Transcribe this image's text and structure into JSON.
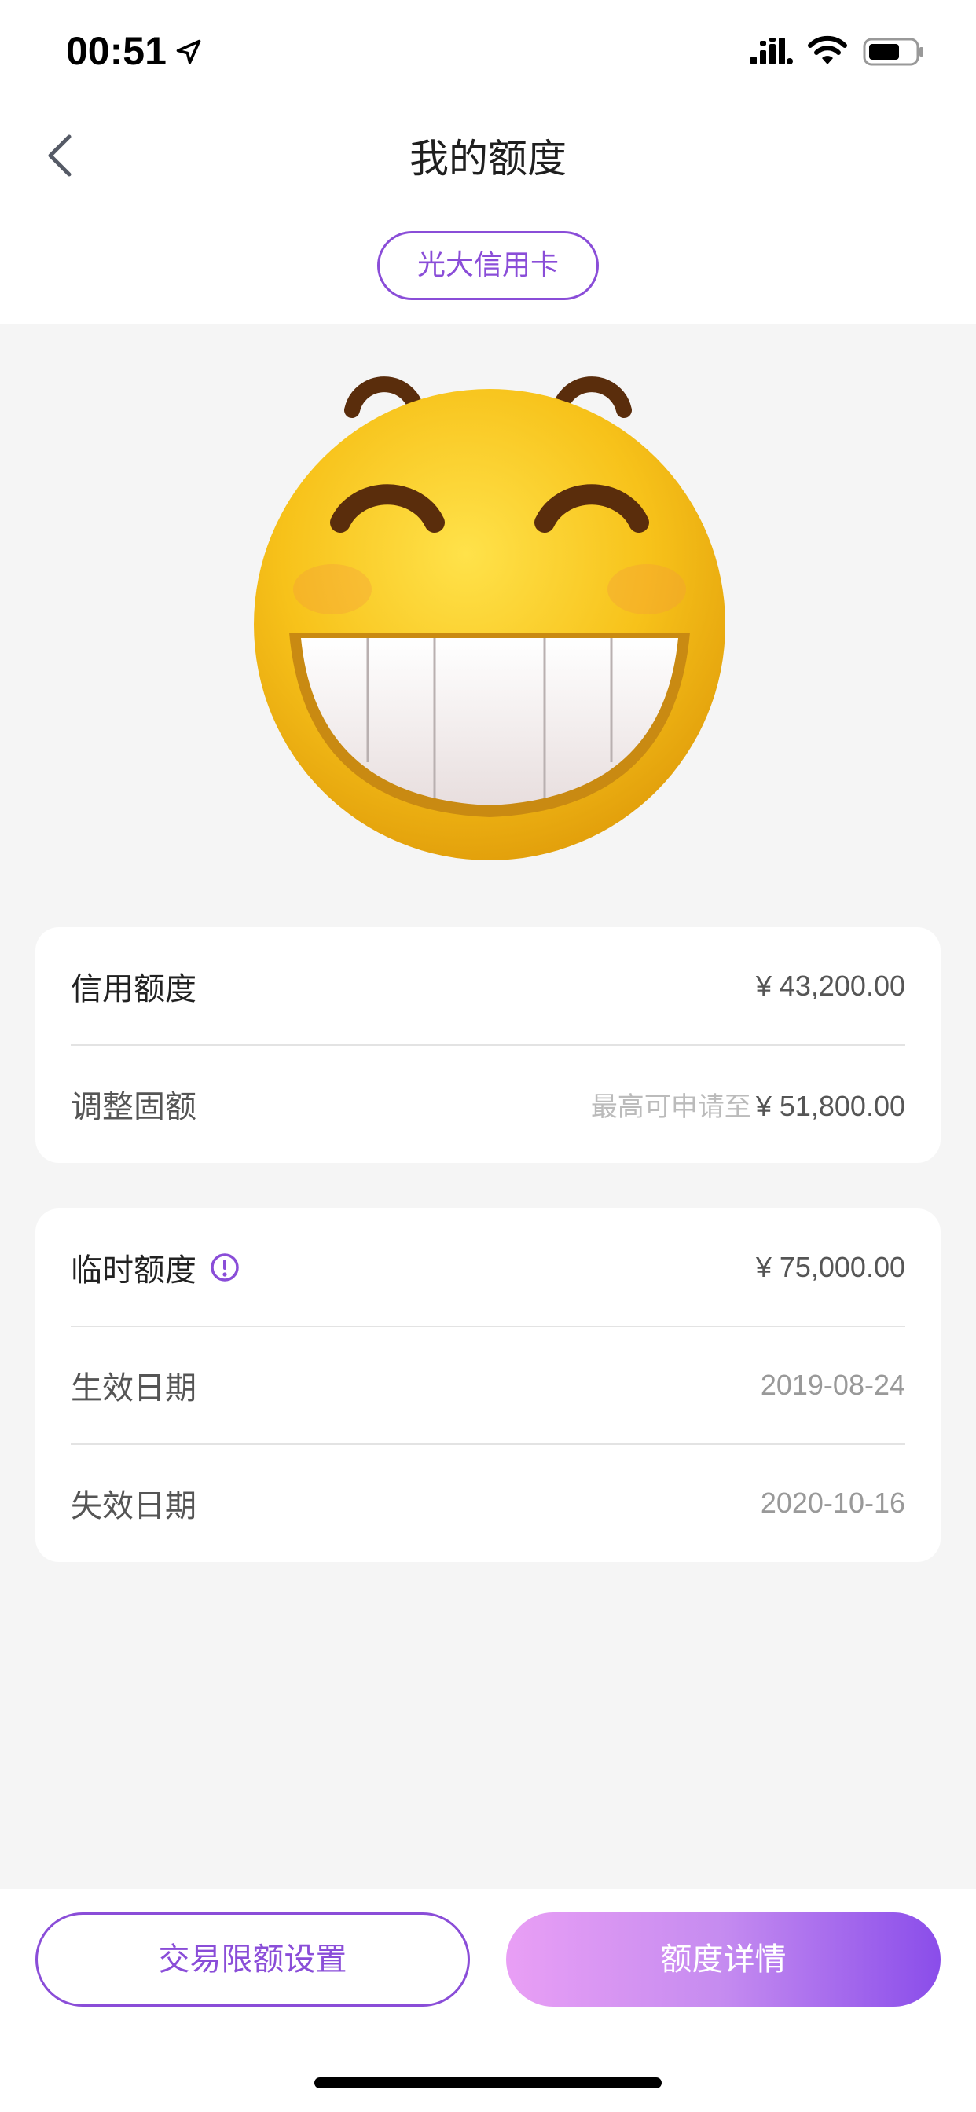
{
  "status_bar": {
    "time": "00:51"
  },
  "nav": {
    "title": "我的额度"
  },
  "card_selector": {
    "label": "光大信用卡"
  },
  "credit_card": {
    "credit_limit_label": "信用额度",
    "credit_limit_value": "¥ 43,200.00",
    "adjust_label": "调整固额",
    "adjust_hint": "最高可申请至",
    "adjust_value": "¥ 51,800.00"
  },
  "temp_card": {
    "temp_label": "临时额度",
    "temp_value": "¥ 75,000.00",
    "effective_label": "生效日期",
    "effective_value": "2019-08-24",
    "expiry_label": "失效日期",
    "expiry_value": "2020-10-16"
  },
  "actions": {
    "limit_settings": "交易限额设置",
    "limit_details": "额度详情"
  },
  "colors": {
    "accent": "#8a4dd8",
    "gradient_start": "#e99ff5",
    "gradient_end": "#8a4dea",
    "emoji_yellow": "#f7c21a"
  }
}
